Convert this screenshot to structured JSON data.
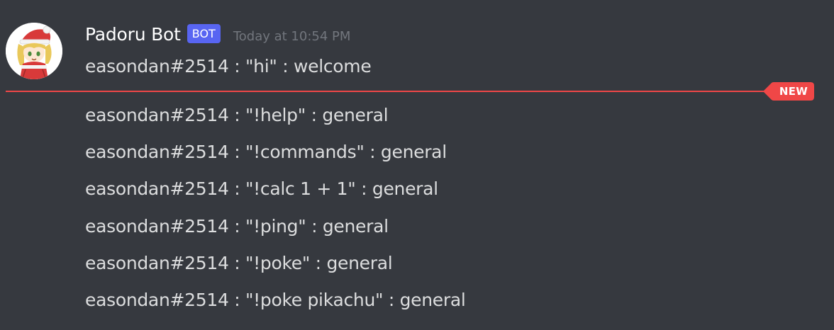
{
  "message": {
    "username": "Padoru Bot",
    "bot_tag": "BOT",
    "timestamp": "Today at 10:54 PM",
    "avatar_icon": "padoru-avatar",
    "lines_before_divider": [
      "easondan#2514 : \"hi\" : welcome"
    ],
    "new_divider_label": "NEW",
    "lines_after_divider": [
      "easondan#2514 : \"!help\" : general",
      "easondan#2514 : \"!commands\" : general",
      "easondan#2514 : \"!calc 1 + 1\" : general",
      "easondan#2514 : \"!ping\" : general",
      "easondan#2514 : \"!poke\" : general",
      "easondan#2514 : \"!poke pikachu\" : general"
    ]
  },
  "colors": {
    "background": "#36393f",
    "username": "#ffffff",
    "message_text": "#dcddde",
    "timestamp": "#72767d",
    "bot_tag": "#5865f2",
    "new_divider": "#f04747"
  }
}
